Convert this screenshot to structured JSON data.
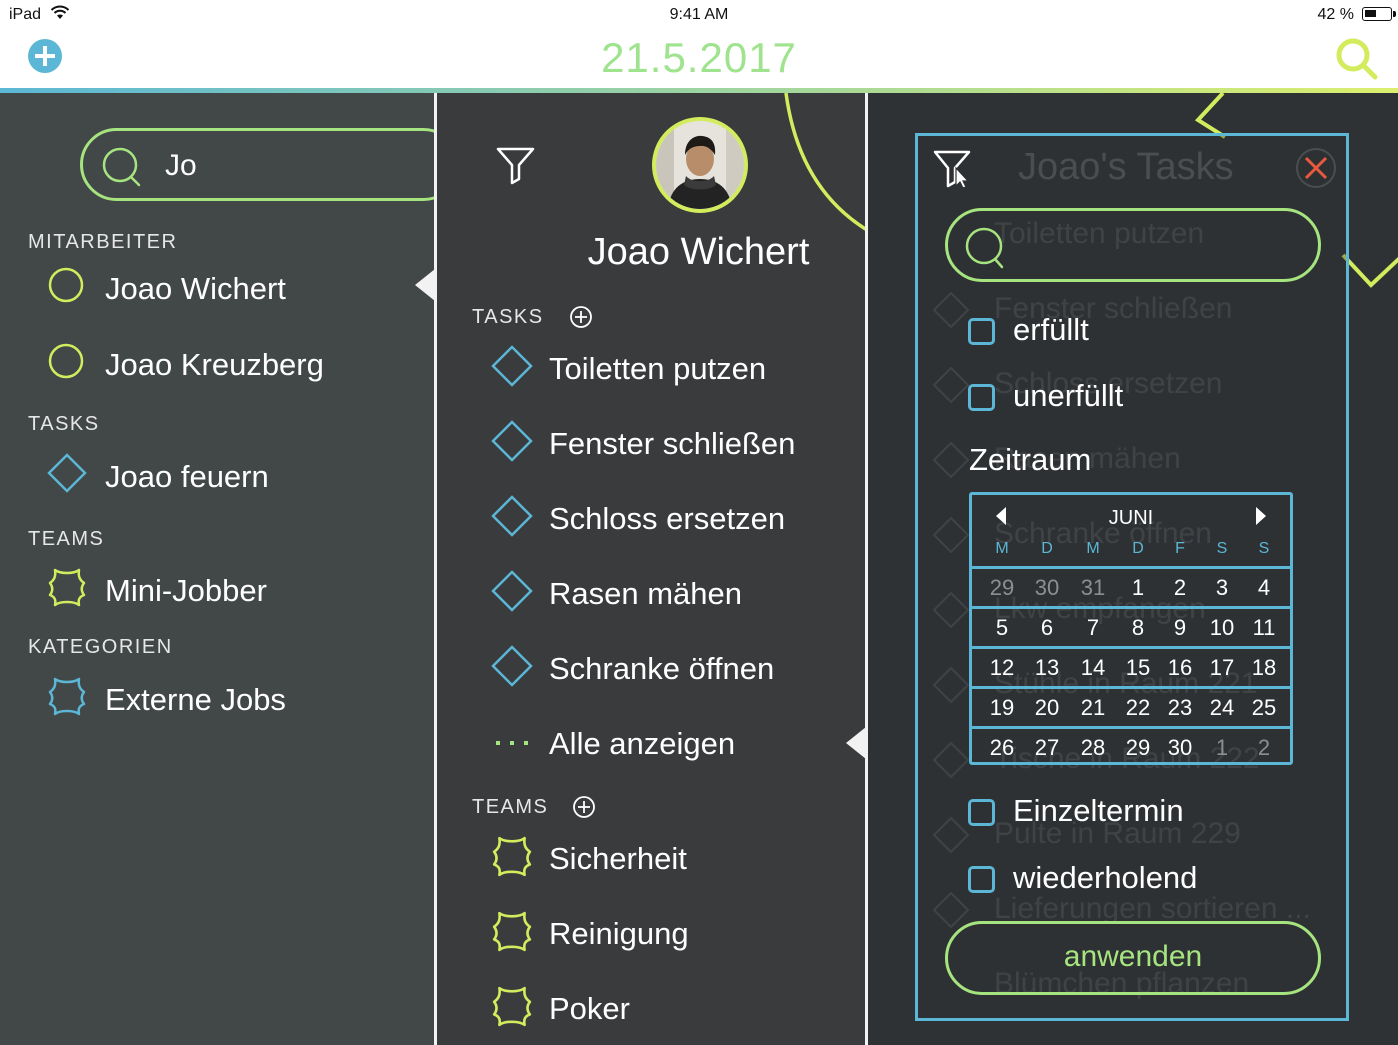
{
  "status_bar": {
    "device": "iPad",
    "time": "9:41 AM",
    "battery": "42 %"
  },
  "header": {
    "date": "21.5.2017",
    "add_icon": "plus-circle-icon",
    "search_icon": "search-icon"
  },
  "colors": {
    "accent_green": "#a6e47f",
    "accent_blue": "#5bb7d5",
    "accent_yellow": "#d2ec5e",
    "date_green": "#9fe38e"
  },
  "search": {
    "query": "Jo"
  },
  "results": {
    "employees_header": "MITARBEITER",
    "employees": [
      {
        "label": "Joao Wichert"
      },
      {
        "label": "Joao Kreuzberg"
      }
    ],
    "tasks_header": "TASKS",
    "tasks": [
      {
        "label": "Joao feuern"
      }
    ],
    "teams_header": "TEAMS",
    "teams": [
      {
        "label": "Mini-Jobber"
      }
    ],
    "categories_header": "KATEGORIEN",
    "categories": [
      {
        "label": "Externe Jobs"
      }
    ]
  },
  "profile": {
    "name": "Joao Wichert",
    "tasks_header": "TASKS",
    "tasks": [
      {
        "label": "Toiletten putzen"
      },
      {
        "label": "Fenster schließen"
      },
      {
        "label": "Schloss ersetzen"
      },
      {
        "label": "Rasen mähen"
      },
      {
        "label": "Schranke öffnen"
      }
    ],
    "show_all": "Alle anzeigen",
    "teams_header": "TEAMS",
    "teams": [
      {
        "label": "Sicherheit"
      },
      {
        "label": "Reinigung"
      },
      {
        "label": "Poker"
      }
    ]
  },
  "task_panel": {
    "title": "Joao's Tasks",
    "items": [
      {
        "label": "Toiletten putzen"
      },
      {
        "label": "Fenster schließen"
      },
      {
        "label": "Schloss ersetzen"
      },
      {
        "label": "Rasen mähen"
      },
      {
        "label": "Schranke öffnen"
      },
      {
        "label": "Lkw empfangen"
      },
      {
        "label": "Stühle in Raum 221"
      },
      {
        "label": "Tische in Raum 222"
      },
      {
        "label": "Pulte in Raum 229"
      },
      {
        "label": "Lieferungen sortieren ..."
      },
      {
        "label": "Blümchen pflanzen"
      }
    ]
  },
  "filter": {
    "status_options": [
      {
        "label": "erfüllt",
        "checked": false
      },
      {
        "label": "unerfüllt",
        "checked": false
      }
    ],
    "period_label": "Zeitraum",
    "calendar": {
      "month": "JUNI",
      "weekdays": [
        "M",
        "D",
        "M",
        "D",
        "F",
        "S",
        "S"
      ],
      "weeks": [
        [
          "29",
          "30",
          "31",
          "1",
          "2",
          "3",
          "4"
        ],
        [
          "5",
          "6",
          "7",
          "8",
          "9",
          "10",
          "11"
        ],
        [
          "12",
          "13",
          "14",
          "15",
          "16",
          "17",
          "18"
        ],
        [
          "19",
          "20",
          "21",
          "22",
          "23",
          "24",
          "25"
        ],
        [
          "26",
          "27",
          "28",
          "29",
          "30",
          "1",
          "2"
        ]
      ]
    },
    "type_options": [
      {
        "label": "Einzeltermin",
        "checked": false
      },
      {
        "label": "wiederholend",
        "checked": false
      }
    ],
    "apply_label": "anwenden"
  }
}
